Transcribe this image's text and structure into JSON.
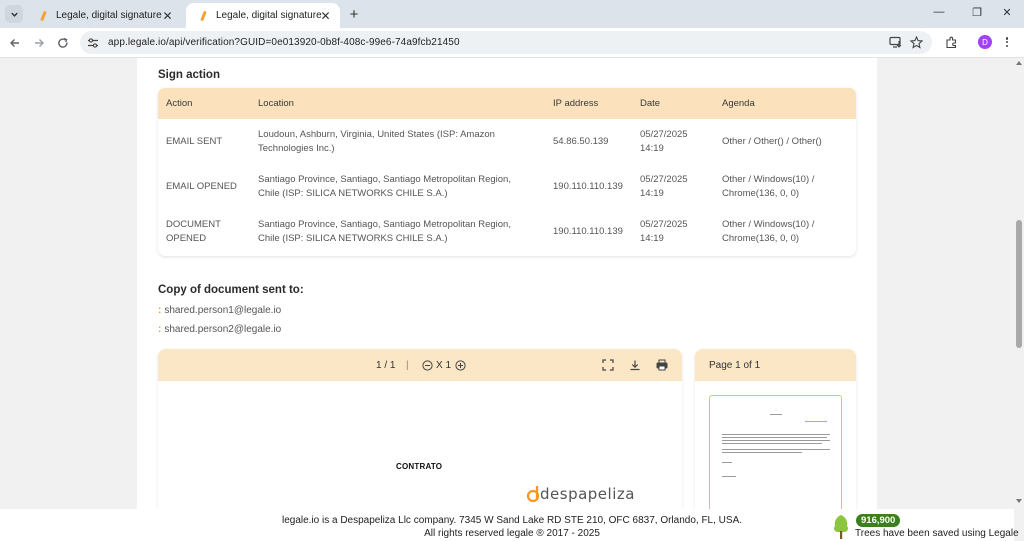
{
  "browser": {
    "tabs": [
      {
        "label": "Legale, digital signature",
        "active": false
      },
      {
        "label": "Legale, digital signature",
        "active": true
      }
    ],
    "url": "app.legale.io/api/verification?GUID=0e013920-0b8f-408c-99e6-74a9fcb21450",
    "profile_initial": "D",
    "icons": {
      "tab_menu": "chevron-down-icon",
      "back": "arrow-left-icon",
      "forward": "arrow-right-icon",
      "reload": "reload-icon",
      "site_info": "tune-icon",
      "install": "install-app-icon",
      "bookmark": "star-icon",
      "extensions": "puzzle-icon",
      "menu": "kebab-menu-icon"
    }
  },
  "sign_action": {
    "title": "Sign action",
    "columns": [
      "Action",
      "Location",
      "IP address",
      "Date",
      "Agenda"
    ],
    "rows": [
      {
        "action": "EMAIL SENT",
        "location": "Loudoun, Ashburn, Virginia, United States (ISP: Amazon Technologies Inc.)",
        "ip": "54.86.50.139",
        "date": "05/27/2025 14:19",
        "agenda": "Other / Other() / Other()"
      },
      {
        "action": "EMAIL OPENED",
        "location": "Santiago Province, Santiago, Santiago Metropolitan Region, Chile (ISP: SILICA NETWORKS CHILE S.A.)",
        "ip": "190.110.110.139",
        "date": "05/27/2025 14:19",
        "agenda": "Other / Windows(10) / Chrome(136, 0, 0)"
      },
      {
        "action": "DOCUMENT OPENED",
        "location": "Santiago Province, Santiago, Santiago Metropolitan Region, Chile (ISP: SILICA NETWORKS CHILE S.A.)",
        "ip": "190.110.110.139",
        "date": "05/27/2025 14:19",
        "agenda": "Other / Windows(10) / Chrome(136, 0, 0)"
      }
    ]
  },
  "copy_sent": {
    "title": "Copy of document sent to:",
    "emails": [
      "shared.person1@legale.io",
      "shared.person2@legale.io"
    ]
  },
  "viewer": {
    "page_indicator": "1 / 1",
    "separator": "|",
    "zoom_label": "X 1",
    "page_of": "Page 1 of 1",
    "document_title": "CONTRATO",
    "logo_text": "despapeliza",
    "accent_color": "#fbe6c6"
  },
  "footer": {
    "line1": "legale.io is a Despapeliza Llc company. 7345 W Sand Lake RD STE 210, OFC 6837, Orlando, FL, USA.",
    "line2": "All rights reserved legale ® 2017 - 2025",
    "trees_count": "916,900",
    "trees_text": "Trees have been saved using Legale"
  }
}
